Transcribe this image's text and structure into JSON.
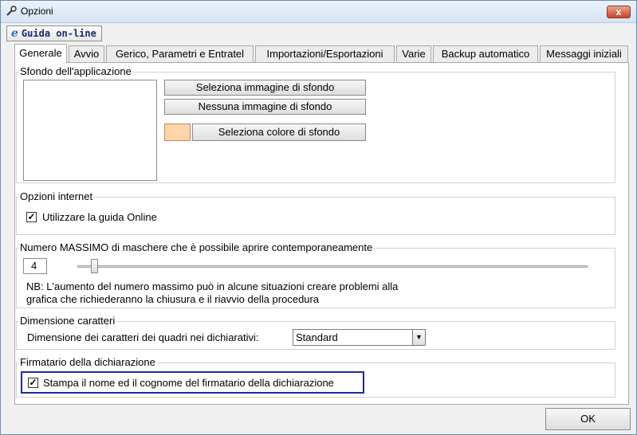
{
  "window": {
    "title": "Opzioni",
    "close_glyph": "x"
  },
  "help_button": {
    "label": "Guida on-line",
    "icon": "internet-explorer-icon"
  },
  "tabs": [
    {
      "label": "Generale"
    },
    {
      "label": "Avvio"
    },
    {
      "label": "Gerico, Parametri e Entratel"
    },
    {
      "label": "Importazioni/Esportazioni"
    },
    {
      "label": "Varie"
    },
    {
      "label": "Backup automatico"
    },
    {
      "label": "Messaggi iniziali"
    }
  ],
  "background": {
    "legend": "Sfondo dell'applicazione",
    "select_image": "Seleziona immagine di sfondo",
    "no_image": "Nessuna immagine di sfondo",
    "select_color": "Seleziona colore di sfondo",
    "swatch_color": "#ffd4a8"
  },
  "internet": {
    "legend": "Opzioni internet",
    "online_help_label": "Utilizzare la guida Online",
    "online_help_checked": true
  },
  "max_windows": {
    "legend": "Numero MASSIMO di maschere che è possibile aprire contemporaneamente",
    "value": "4",
    "note_line1": "NB: L'aumento del numero massimo può in alcune situazioni creare problemi alla",
    "note_line2": "grafica che richiederanno la chiusura e il riavvio della procedura"
  },
  "font_size": {
    "legend": "Dimensione caratteri",
    "label": "Dimensione dei caratteri dei quadri nei dichiarativi:",
    "selected": "Standard"
  },
  "signatory": {
    "legend": "Firmatario della dichiarazione",
    "print_name_label": "Stampa il nome ed il cognome del firmatario della dichiarazione",
    "print_name_checked": true
  },
  "ok_button": "OK"
}
